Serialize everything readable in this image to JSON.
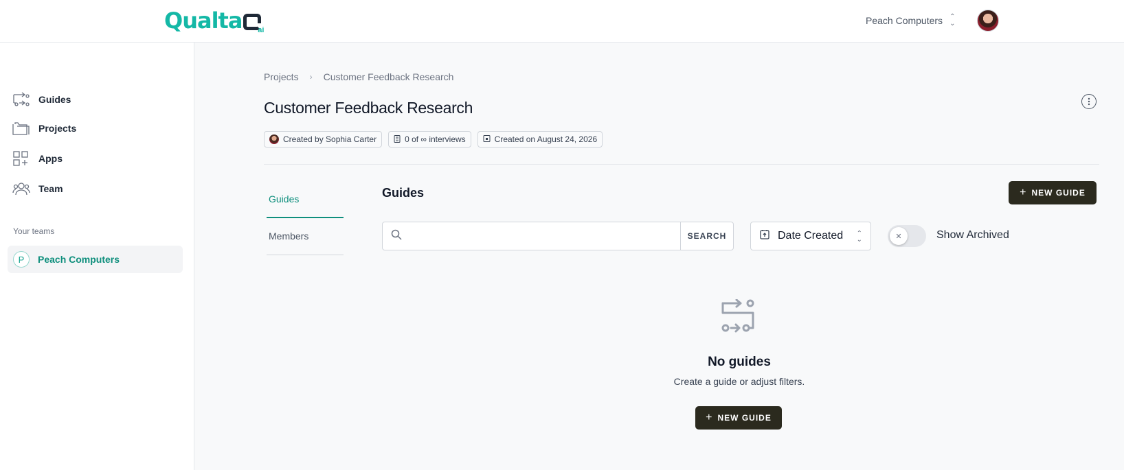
{
  "header": {
    "logo_text": "Qualta",
    "logo_suffix": "ai",
    "org_name": "Peach Computers",
    "avatar": "user-avatar"
  },
  "sidebar": {
    "items": [
      {
        "label": "Guides",
        "icon": "guides-icon"
      },
      {
        "label": "Projects",
        "icon": "folder-icon"
      },
      {
        "label": "Apps",
        "icon": "apps-grid-icon"
      },
      {
        "label": "Team",
        "icon": "team-icon"
      }
    ],
    "teams_label": "Your teams",
    "team": {
      "badge": "P",
      "name": "Peach Computers"
    }
  },
  "breadcrumb": {
    "root": "Projects",
    "separator": "›",
    "current": "Customer Feedback Research"
  },
  "project": {
    "title": "Customer Feedback Research",
    "created_by": "Created by Sophia Carter",
    "interviews": "0 of ∞ interviews",
    "created_on": "Created on August 24, 2026"
  },
  "tabs": [
    {
      "label": "Guides",
      "active": true
    },
    {
      "label": "Members",
      "active": false
    }
  ],
  "guides_section": {
    "title": "Guides",
    "new_button": "NEW GUIDE",
    "search_placeholder": "",
    "search_button": "SEARCH",
    "sort_value": "Date Created",
    "toggle_label": "Show Archived",
    "toggle_on": false
  },
  "empty_state": {
    "title": "No guides",
    "description": "Create a guide or adjust filters.",
    "button": "NEW GUIDE"
  },
  "colors": {
    "brand": "#14b8a6",
    "active_green": "#0f8f7d",
    "dark_button": "#2b2a1e"
  }
}
